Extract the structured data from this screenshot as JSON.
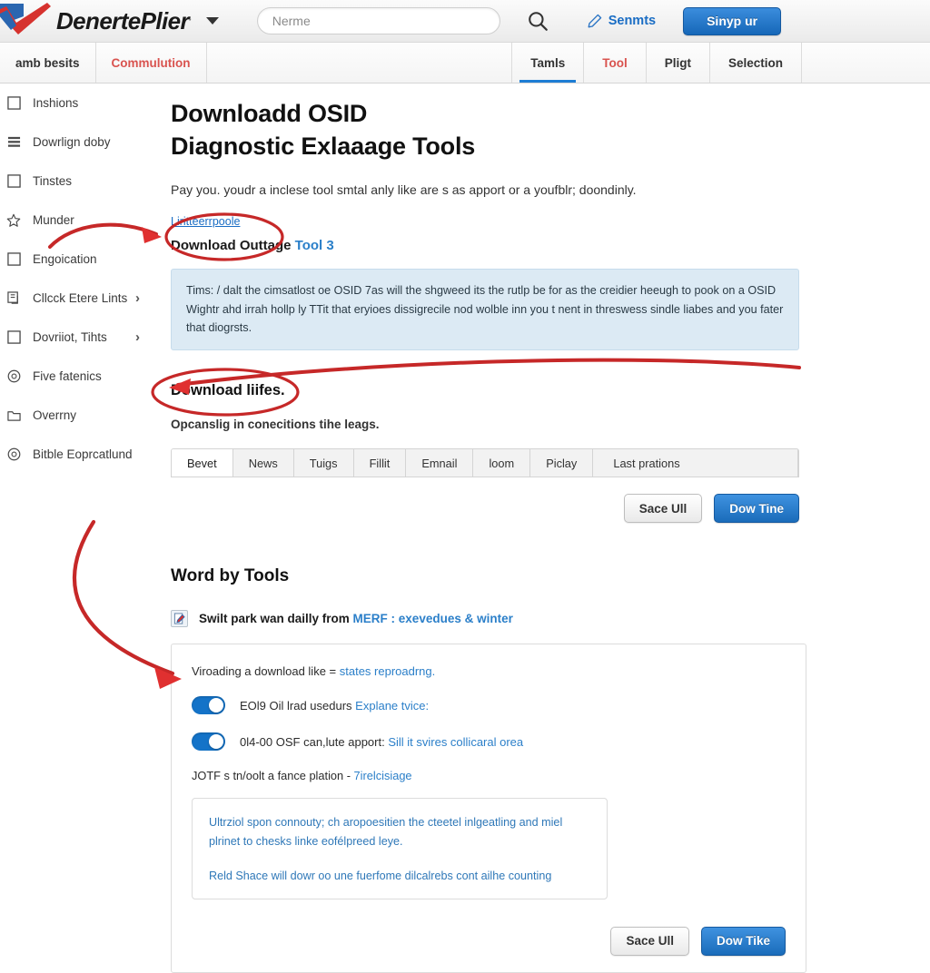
{
  "header": {
    "brand": "DenertePlier",
    "brand_mark": ".",
    "caret_icon": "chevron-down-icon",
    "search_placeholder": "Nerme",
    "search_value": "",
    "search_icon": "search-icon",
    "edit_icon": "pencil-icon",
    "link_label": "Senmts",
    "signup_label": "Sinyp ur",
    "accent_blue": "#1667b8"
  },
  "navbar": {
    "left_items": [
      {
        "label": "amb besits",
        "color": "dark"
      },
      {
        "label": "Commulution",
        "color": "red"
      }
    ],
    "right_tabs": [
      {
        "label": "Tamls",
        "active": true,
        "color": "dark"
      },
      {
        "label": "Tool",
        "active": false,
        "color": "red"
      },
      {
        "label": "Pligt",
        "active": false,
        "color": "dark"
      },
      {
        "label": "Selection",
        "active": false,
        "color": "dark"
      }
    ]
  },
  "sidebar": {
    "items": [
      {
        "label": "Inshions",
        "icon": "square-icon",
        "chevron": false
      },
      {
        "label": "Dowrlign doby",
        "icon": "list-icon",
        "chevron": false
      },
      {
        "label": "Tinstes",
        "icon": "square-icon",
        "chevron": false
      },
      {
        "label": "Munder",
        "icon": "star-icon",
        "chevron": false
      },
      {
        "label": "Engoication",
        "icon": "square-icon",
        "chevron": false
      },
      {
        "label": "Cllcck Etere Lints",
        "icon": "copy-icon",
        "chevron": true
      },
      {
        "label": "Dovriiot, Tihts",
        "icon": "square-icon",
        "chevron": true
      },
      {
        "label": "Five fatenics",
        "icon": "circle-dot-icon",
        "chevron": false
      },
      {
        "label": "Overrny",
        "icon": "folder-icon",
        "chevron": false
      },
      {
        "label": "Bitble Eoprcatlund",
        "icon": "circle-dot-icon",
        "chevron": false
      }
    ],
    "chevron_glyph": "›"
  },
  "main": {
    "title_line1": "Downloadd OSID",
    "title_line2": "Diagnostic Exlaaage Tools",
    "lead": "Pay you. youdr a inclese tool smtal anly like are s as apport or a youfblr; doondinly.",
    "inline_link": "Liritteerrpoole",
    "sub_bold_dark": "Download Outtage",
    "sub_bold_blue": "Tool 3",
    "infobox": "Tims: / dalt the cimsatlost oe OSID 7as will the shgweed its the rutlp be for as the creidier heeugh to pook on a OSID Wightr ahd irrah hollp ly TTit that eryioes dissigrecile nod wolble inn you t nent in threswess sindle liabes and you fater that diogrsts.",
    "section2_title": "Download liifes.",
    "section2_sub": "Opcanslig in conecitions tihe leags.",
    "tabs": [
      {
        "label": "Bevet",
        "active": true
      },
      {
        "label": "News",
        "active": false
      },
      {
        "label": "Tuigs",
        "active": false
      },
      {
        "label": "Fillit",
        "active": false
      },
      {
        "label": "Emnail",
        "active": false
      },
      {
        "label": "loom",
        "active": false
      },
      {
        "label": "Piclay",
        "active": false
      },
      {
        "label": "Last prations",
        "active": false
      }
    ],
    "buttons_top": {
      "secondary": "Sace Ull",
      "primary": "Dow Tine"
    },
    "section3_title": "Word by Tools",
    "note_icon": "document-edit-icon",
    "note_text_dark": "Swilt park wan dailly from ",
    "note_text_blue": "MERF : exevedues & winter",
    "card": {
      "lead_dark": "Viroading a download like = ",
      "lead_blue": "states reproadrng.",
      "toggles": [
        {
          "state": "on",
          "label_dark": "ЕOl9 Oil lrad usedurs ",
          "label_blue": "Explane tvice:"
        },
        {
          "state": "on",
          "label_dark": "0l4-00 OSF can,lute apport: ",
          "label_blue": "Sill it svires collicaral orea"
        }
      ],
      "sub_dark": "JОTF s tn/oolt a fance plation - ",
      "sub_blue": "7irelcisiage",
      "inner_box": {
        "p1": "Ultrziol spon connouty; ch aropoesitien the cteetel inlgeatling and miel plrinet to chesks linke eofélpreed leye.",
        "p2": "Reld Shace will dowr oo une fuerfome dilcalrebs cont ailhe counting"
      },
      "buttons_bottom": {
        "secondary": "Sace Ull",
        "primary": "Dow Tike"
      }
    }
  },
  "annotations": {
    "color": "#c62828",
    "items": [
      {
        "type": "ellipse-arrow",
        "target": "inline-link"
      },
      {
        "type": "ellipse-arrow",
        "target": "section2-title"
      },
      {
        "type": "curved-arrow",
        "target": "first-toggle"
      }
    ]
  }
}
